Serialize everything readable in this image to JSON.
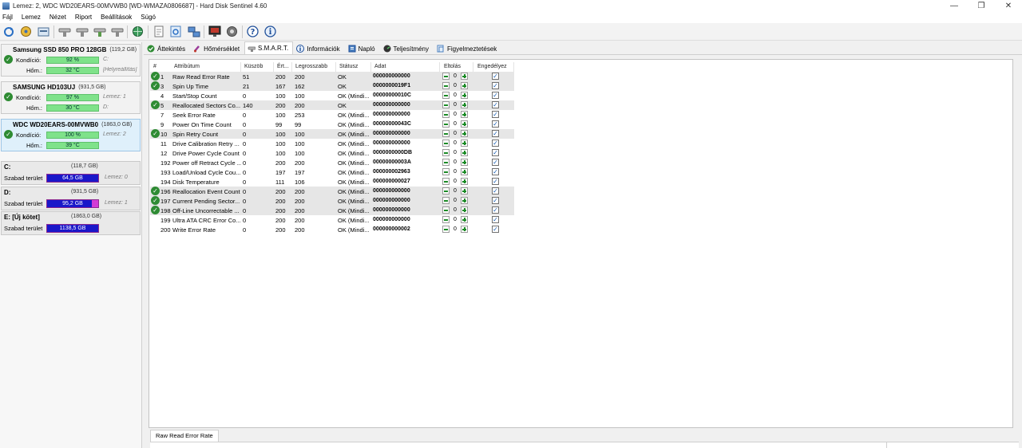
{
  "window": {
    "title": "Lemez: 2, WDC WD20EARS-00MVWB0 [WD-WMAZA0806687]  -  Hard Disk Sentinel 4.60",
    "controls": [
      "minimize-icon",
      "restore-icon",
      "close-icon"
    ]
  },
  "menu": [
    "Fájl",
    "Lemez",
    "Nézet",
    "Riport",
    "Beállítások",
    "Súgó"
  ],
  "toolbar": {
    "buttons": [
      "refresh-icon",
      "disk-info-icon",
      "disk-report-icon",
      "test-icon",
      "test-icon",
      "test-icon",
      "test-icon",
      "globe-icon",
      "page-icon",
      "refresh-page-icon",
      "network-icon",
      "monitor-icon",
      "settings-icon",
      "help-icon",
      "info-icon"
    ]
  },
  "disks": [
    {
      "name": "Samsung SSD 850 PRO 128GB",
      "size": "(119,2 GB)",
      "size_aux": "Le",
      "health_label": "Kondíció:",
      "health": "92 %",
      "health_aux": "C:",
      "temp_label": "Hőm.:",
      "temp": "32 °C",
      "temp_aux": "[Helyreállítás]",
      "selected": false
    },
    {
      "name": "SAMSUNG HD103UJ",
      "size": "(931,5 GB)",
      "size_aux": "",
      "health_label": "Kondíció:",
      "health": "97 %",
      "health_aux": "Lemez: 1",
      "temp_label": "Hőm.:",
      "temp": "30 °C",
      "temp_aux": "D:",
      "selected": false
    },
    {
      "name": "WDC WD20EARS-00MVWB0",
      "size": "(1863,0 GB)",
      "size_aux": "",
      "health_label": "Kondíció:",
      "health": "100 %",
      "health_aux": "Lemez: 2",
      "temp_label": "Hőm.:",
      "temp": "39 °C",
      "temp_aux": "",
      "selected": true
    }
  ],
  "volumes": [
    {
      "letter": "C:",
      "size": "(118,7 GB)",
      "free_label": "Szabad terület",
      "free": "64,5 GB",
      "used_fraction": 0.0,
      "aux": "Lemez: 0"
    },
    {
      "letter": "D:",
      "size": "(931,5 GB)",
      "free_label": "Szabad terület",
      "free": "95,2 GB",
      "used_fraction": 0.9,
      "aux": "Lemez: 1"
    },
    {
      "letter": "E: [Új kötet]",
      "size": "(1863,0 GB)",
      "free_label": "Szabad terület",
      "free": "1138,5 GB",
      "used_fraction": 0.0,
      "aux": ""
    }
  ],
  "tabs": [
    {
      "label": "Áttekintés",
      "icon": "check-icon",
      "active": false
    },
    {
      "label": "Hőmérséklet",
      "icon": "thermometer-icon",
      "active": false
    },
    {
      "label": "S.M.A.R.T.",
      "icon": "smart-icon",
      "active": true
    },
    {
      "label": "Információk",
      "icon": "info-icon",
      "active": false
    },
    {
      "label": "Napló",
      "icon": "log-icon",
      "active": false
    },
    {
      "label": "Teljesítmény",
      "icon": "performance-icon",
      "active": false
    },
    {
      "label": "Figyelmeztetések",
      "icon": "alert-icon",
      "active": false
    }
  ],
  "smart": {
    "columns": [
      "#",
      "Attribútum",
      "Küszöb",
      "Ért...",
      "Legrosszabb",
      "Státusz",
      "Adat",
      "Eltolás",
      "Engedélyez"
    ],
    "rows": [
      {
        "id": "1",
        "name": "Raw Read Error Rate",
        "threshold": "51",
        "value": "200",
        "worst": "200",
        "status": "OK",
        "data": "000000000000",
        "offset": "0",
        "check": true
      },
      {
        "id": "3",
        "name": "Spin Up Time",
        "threshold": "21",
        "value": "167",
        "worst": "162",
        "status": "OK",
        "data": "0000000019F1",
        "offset": "0",
        "check": true
      },
      {
        "id": "4",
        "name": "Start/Stop Count",
        "threshold": "0",
        "value": "100",
        "worst": "100",
        "status": "OK (Mindi...",
        "data": "00000000010C",
        "offset": "0",
        "check": false
      },
      {
        "id": "5",
        "name": "Reallocated Sectors Co...",
        "threshold": "140",
        "value": "200",
        "worst": "200",
        "status": "OK",
        "data": "000000000000",
        "offset": "0",
        "check": true
      },
      {
        "id": "7",
        "name": "Seek Error Rate",
        "threshold": "0",
        "value": "100",
        "worst": "253",
        "status": "OK (Mindi...",
        "data": "000000000000",
        "offset": "0",
        "check": false
      },
      {
        "id": "9",
        "name": "Power On Time Count",
        "threshold": "0",
        "value": "99",
        "worst": "99",
        "status": "OK (Mindi...",
        "data": "00000000043C",
        "offset": "0",
        "check": false
      },
      {
        "id": "10",
        "name": "Spin Retry Count",
        "threshold": "0",
        "value": "100",
        "worst": "100",
        "status": "OK (Mindi...",
        "data": "000000000000",
        "offset": "0",
        "check": true
      },
      {
        "id": "11",
        "name": "Drive Calibration Retry ...",
        "threshold": "0",
        "value": "100",
        "worst": "100",
        "status": "OK (Mindi...",
        "data": "000000000000",
        "offset": "0",
        "check": false
      },
      {
        "id": "12",
        "name": "Drive Power Cycle Count",
        "threshold": "0",
        "value": "100",
        "worst": "100",
        "status": "OK (Mindi...",
        "data": "0000000000DB",
        "offset": "0",
        "check": false
      },
      {
        "id": "192",
        "name": "Power off Retract Cycle ...",
        "threshold": "0",
        "value": "200",
        "worst": "200",
        "status": "OK (Mindi...",
        "data": "00000000003A",
        "offset": "0",
        "check": false
      },
      {
        "id": "193",
        "name": "Load/Unload Cycle Cou...",
        "threshold": "0",
        "value": "197",
        "worst": "197",
        "status": "OK (Mindi...",
        "data": "000000002963",
        "offset": "0",
        "check": false
      },
      {
        "id": "194",
        "name": "Disk Temperature",
        "threshold": "0",
        "value": "111",
        "worst": "106",
        "status": "OK (Mindi...",
        "data": "000000000027",
        "offset": "0",
        "check": false
      },
      {
        "id": "196",
        "name": "Reallocation Event Count",
        "threshold": "0",
        "value": "200",
        "worst": "200",
        "status": "OK (Mindi...",
        "data": "000000000000",
        "offset": "0",
        "check": true
      },
      {
        "id": "197",
        "name": "Current Pending Sector...",
        "threshold": "0",
        "value": "200",
        "worst": "200",
        "status": "OK (Mindi...",
        "data": "000000000000",
        "offset": "0",
        "check": true
      },
      {
        "id": "198",
        "name": "Off-Line Uncorrectable ...",
        "threshold": "0",
        "value": "200",
        "worst": "200",
        "status": "OK (Mindi...",
        "data": "000000000000",
        "offset": "0",
        "check": true
      },
      {
        "id": "199",
        "name": "Ultra ATA CRC Error Co...",
        "threshold": "0",
        "value": "200",
        "worst": "200",
        "status": "OK (Mindi...",
        "data": "000000000000",
        "offset": "0",
        "check": false
      },
      {
        "id": "200",
        "name": "Write Error Rate",
        "threshold": "0",
        "value": "200",
        "worst": "200",
        "status": "OK (Mindi...",
        "data": "000000000002",
        "offset": "0",
        "check": false
      }
    ]
  },
  "detail": {
    "tab_label": "Raw Read Error Rate"
  },
  "colors": {
    "health_bar": "#7fe28a",
    "volume_free": "#1a17c9",
    "volume_used": "#d23bd6",
    "ok_badge": "#2e8b33"
  }
}
